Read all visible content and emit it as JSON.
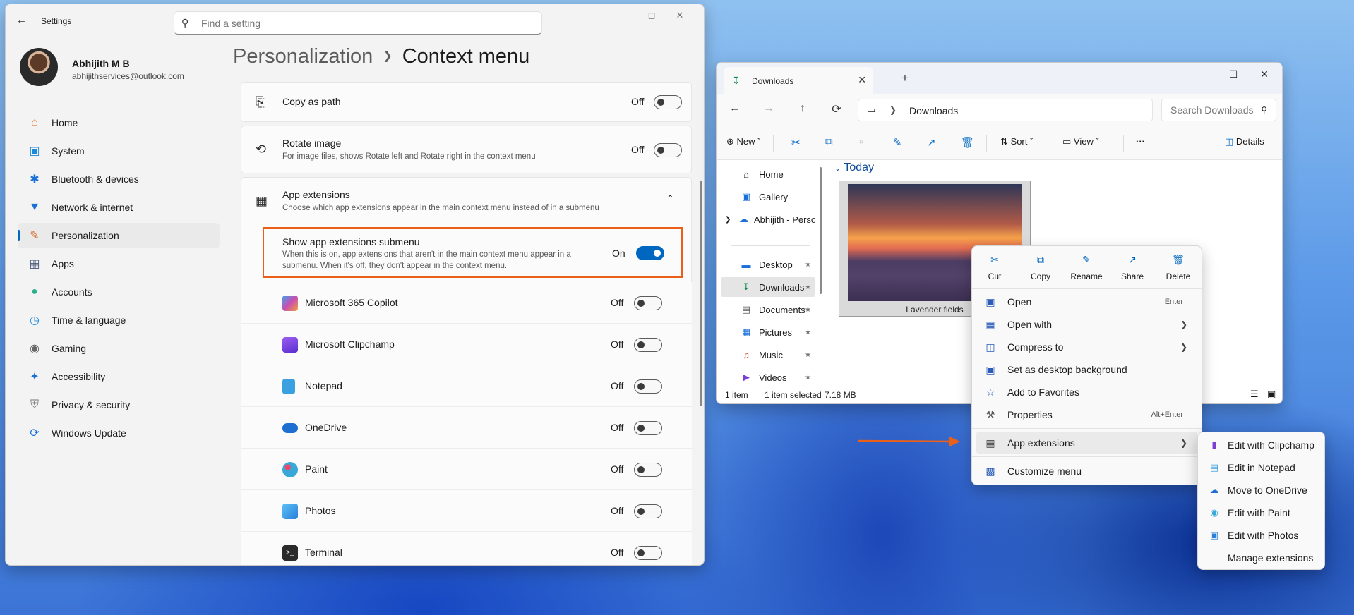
{
  "settings": {
    "app_title": "Settings",
    "search_placeholder": "Find a setting",
    "user": {
      "name": "Abhijith M B",
      "email": "abhijithservices@outlook.com"
    },
    "nav": [
      {
        "label": "Home",
        "icon": "home-icon"
      },
      {
        "label": "System",
        "icon": "system-icon"
      },
      {
        "label": "Bluetooth & devices",
        "icon": "bluetooth-icon"
      },
      {
        "label": "Network & internet",
        "icon": "wifi-icon"
      },
      {
        "label": "Personalization",
        "icon": "brush-icon",
        "active": true
      },
      {
        "label": "Apps",
        "icon": "apps-icon"
      },
      {
        "label": "Accounts",
        "icon": "person-icon"
      },
      {
        "label": "Time & language",
        "icon": "globe-icon"
      },
      {
        "label": "Gaming",
        "icon": "gamepad-icon"
      },
      {
        "label": "Accessibility",
        "icon": "accessibility-icon"
      },
      {
        "label": "Privacy & security",
        "icon": "shield-icon"
      },
      {
        "label": "Windows Update",
        "icon": "update-icon"
      }
    ],
    "breadcrumb": {
      "parent": "Personalization",
      "current": "Context menu"
    },
    "cards": {
      "copy_path": {
        "title": "Copy as path",
        "state": "Off"
      },
      "rotate": {
        "title": "Rotate image",
        "subtitle": "For image files, shows Rotate left and Rotate right in the context menu",
        "state": "Off"
      },
      "app_ext": {
        "title": "App extensions",
        "subtitle": "Choose which app extensions appear in the main context menu instead of in a submenu"
      },
      "show_submenu": {
        "title": "Show app extensions submenu",
        "line1": "When this is on, app extensions that aren't in the main context menu appear in a",
        "line2": "submenu. When it's off, they don't appear in the context menu.",
        "state": "On"
      }
    },
    "extensions": [
      {
        "label": "Microsoft 365 Copilot",
        "state": "Off",
        "icon": "copilot-icon",
        "color": "#c94fb0"
      },
      {
        "label": "Microsoft Clipchamp",
        "state": "Off",
        "icon": "clipchamp-icon",
        "color": "#7b3fd6"
      },
      {
        "label": "Notepad",
        "state": "Off",
        "icon": "notepad-icon",
        "color": "#3aa0e0"
      },
      {
        "label": "OneDrive",
        "state": "Off",
        "icon": "onedrive-icon",
        "color": "#1f6fd0"
      },
      {
        "label": "Paint",
        "state": "Off",
        "icon": "paint-icon",
        "color": "#38a8d8"
      },
      {
        "label": "Photos",
        "state": "Off",
        "icon": "photos-icon",
        "color": "#2b7fd8"
      },
      {
        "label": "Terminal",
        "state": "Off",
        "icon": "terminal-icon",
        "color": "#2b2b2b"
      }
    ]
  },
  "explorer": {
    "tab_title": "Downloads",
    "address": "Downloads",
    "search_placeholder": "Search Downloads",
    "commands": {
      "new": "New",
      "sort": "Sort",
      "view": "View",
      "details": "Details"
    },
    "sidebar": [
      {
        "label": "Home"
      },
      {
        "label": "Gallery"
      },
      {
        "label": "Abhijith - Personal"
      },
      {
        "label": "Desktop"
      },
      {
        "label": "Downloads"
      },
      {
        "label": "Documents"
      },
      {
        "label": "Pictures"
      },
      {
        "label": "Music"
      },
      {
        "label": "Videos"
      }
    ],
    "group": "Today",
    "file": {
      "name": "Lavender fields"
    },
    "status": {
      "items": "1 item",
      "selected": "1 item selected",
      "size": "7.18 MB"
    }
  },
  "context_menu": {
    "quick_actions": [
      "Cut",
      "Copy",
      "Rename",
      "Share",
      "Delete"
    ],
    "items": [
      {
        "label": "Open",
        "shortcut": "Enter"
      },
      {
        "label": "Open with"
      },
      {
        "label": "Compress to"
      },
      {
        "label": "Set as desktop background"
      },
      {
        "label": "Add to Favorites"
      },
      {
        "label": "Properties",
        "shortcut": "Alt+Enter"
      },
      {
        "label": "App extensions"
      },
      {
        "label": "Customize menu"
      }
    ]
  },
  "submenu": {
    "items": [
      {
        "label": "Edit with Clipchamp"
      },
      {
        "label": "Edit in Notepad"
      },
      {
        "label": "Move to OneDrive"
      },
      {
        "label": "Edit with Paint"
      },
      {
        "label": "Edit with Photos"
      },
      {
        "label": "Manage extensions"
      }
    ]
  },
  "colors": {
    "accent": "#0067c0",
    "highlight": "#ea6018"
  }
}
